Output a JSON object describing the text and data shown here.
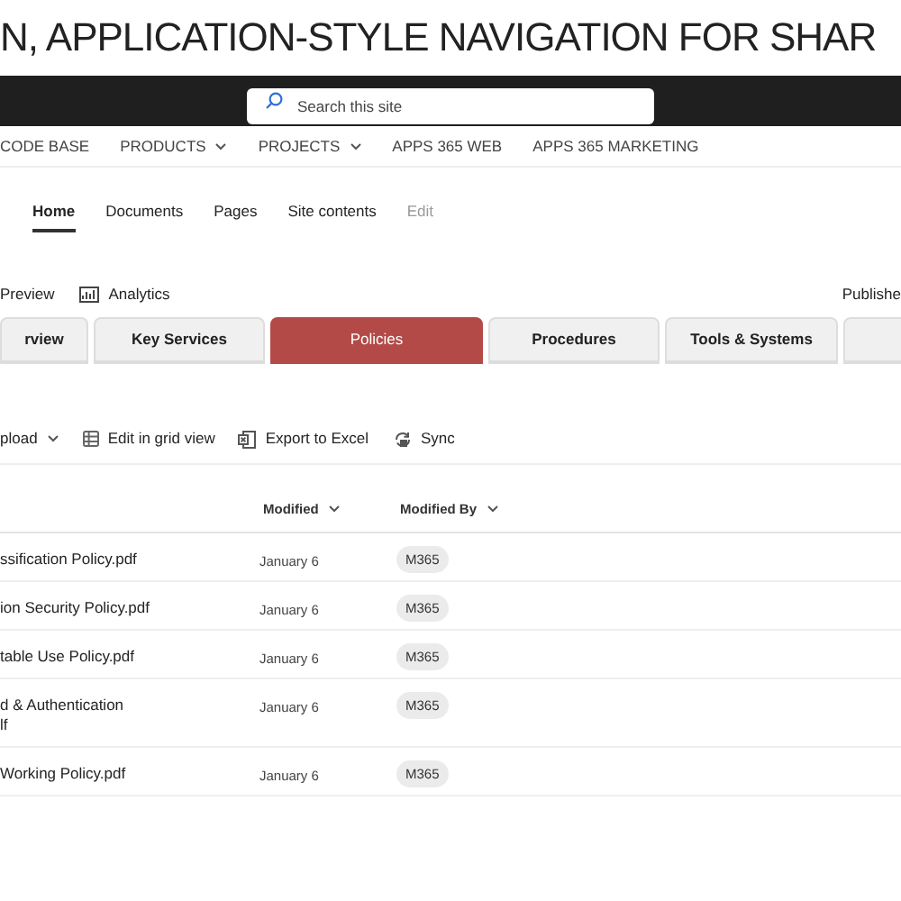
{
  "site_title": "N, APPLICATION-STYLE NAVIGATION FOR SHAR",
  "search": {
    "placeholder": "Search this site"
  },
  "top_nav": [
    {
      "label": "CODE BASE",
      "dropdown": false
    },
    {
      "label": "PRODUCTS",
      "dropdown": true
    },
    {
      "label": "PROJECTS",
      "dropdown": true
    },
    {
      "label": "APPS 365 WEB",
      "dropdown": false
    },
    {
      "label": "APPS 365 MARKETING",
      "dropdown": false
    }
  ],
  "sub_nav": [
    {
      "label": "Home",
      "selected": true,
      "disabled": false
    },
    {
      "label": "Documents",
      "selected": false,
      "disabled": false
    },
    {
      "label": "Pages",
      "selected": false,
      "disabled": false
    },
    {
      "label": "Site contents",
      "selected": false,
      "disabled": false
    },
    {
      "label": "Edit",
      "selected": false,
      "disabled": true
    }
  ],
  "command_bar": {
    "items": [
      {
        "label": "Preview",
        "kind": "plain"
      },
      {
        "label": "Analytics",
        "kind": "analytics"
      }
    ],
    "status": "Publishe"
  },
  "tabs": [
    {
      "label": "rview",
      "selected": false
    },
    {
      "label": "Key Services",
      "selected": false
    },
    {
      "label": "Policies",
      "selected": true
    },
    {
      "label": "Procedures",
      "selected": false
    },
    {
      "label": "Tools & Systems",
      "selected": false
    },
    {
      "selected": false
    }
  ],
  "toolbar": [
    {
      "label": "pload",
      "kind": "dropdown"
    },
    {
      "label": "Edit in grid view",
      "kind": "grid"
    },
    {
      "label": "Export to Excel",
      "kind": "excel"
    },
    {
      "label": "Sync",
      "kind": "sync"
    }
  ],
  "table": {
    "columns": [
      {
        "label": "Modified"
      },
      {
        "label": "Modified By"
      }
    ],
    "rows": [
      {
        "file": "ssification Policy.pdf",
        "modified": "January 6",
        "modified_by": "M365"
      },
      {
        "file": "ion Security Policy.pdf",
        "modified": "January 6",
        "modified_by": "M365"
      },
      {
        "file": "table Use Policy.pdf",
        "modified": "January 6",
        "modified_by": "M365"
      },
      {
        "file": "d & Authentication\nlf",
        "modified": "January 6",
        "modified_by": "M365"
      },
      {
        "file": "Working Policy.pdf",
        "modified": "January 6",
        "modified_by": "M365"
      }
    ]
  }
}
